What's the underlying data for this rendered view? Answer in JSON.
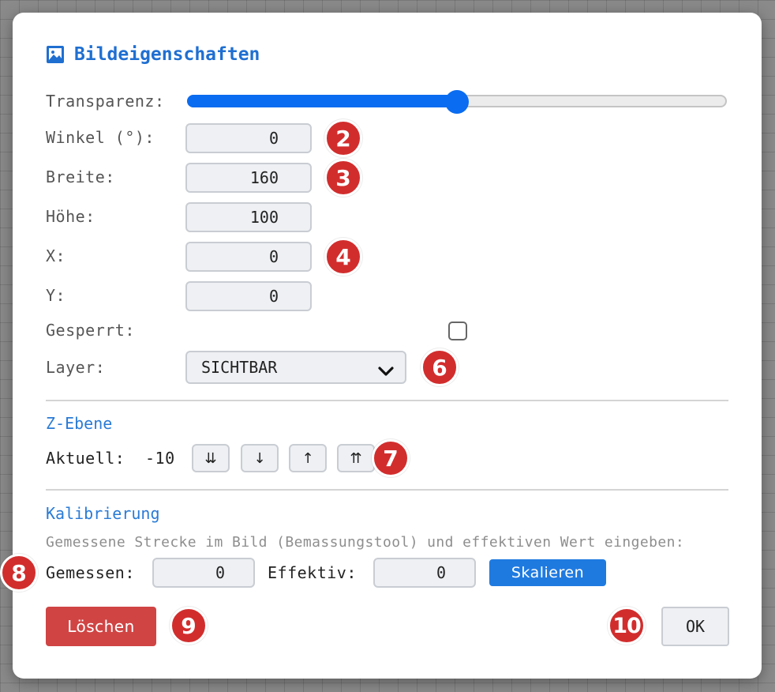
{
  "dialog": {
    "title": "Bildeigenschaften",
    "title_icon": "image-icon",
    "accent_color": "#1f6fd1"
  },
  "props": {
    "transparency_label": "Transparenz:",
    "transparency_value": 0.5,
    "angle_label": "Winkel (°):",
    "angle_value": "0",
    "width_label": "Breite:",
    "width_value": "160",
    "height_label": "Höhe:",
    "height_value": "100",
    "x_label": "X:",
    "x_value": "0",
    "y_label": "Y:",
    "y_value": "0",
    "locked_label": "Gesperrt:",
    "locked_checked": false,
    "layer_label": "Layer:",
    "layer_value": "SICHTBAR"
  },
  "zlevel": {
    "title": "Z-Ebene",
    "current_label": "Aktuell:",
    "current_value": "-10",
    "buttons": [
      "⇊",
      "↓",
      "↑",
      "⇈"
    ]
  },
  "calibration": {
    "title": "Kalibrierung",
    "hint": "Gemessene Strecke im Bild (Bemassungstool) und effektiven Wert eingeben:",
    "measured_label": "Gemessen:",
    "measured_value": "0",
    "effective_label": "Effektiv:",
    "effective_value": "0",
    "scale_button": "Skalieren"
  },
  "footer": {
    "delete_button": "Löschen",
    "ok_button": "OK"
  },
  "badges": [
    "2",
    "3",
    "4",
    "6",
    "7",
    "8",
    "9",
    "10"
  ],
  "colors": {
    "slider": "#0a6cf0",
    "delete": "#d04444",
    "scale": "#1f7ae0",
    "badge": "#d22d2d"
  }
}
